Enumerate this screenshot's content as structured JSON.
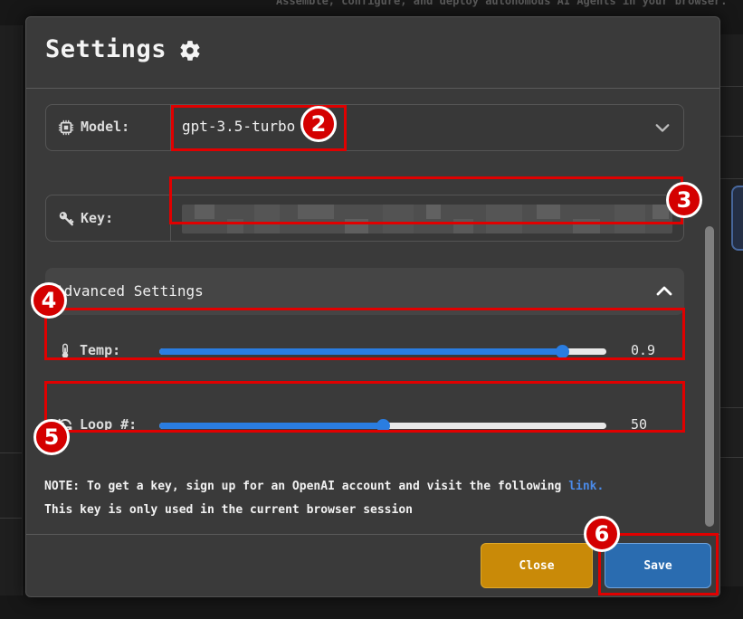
{
  "background": {
    "tagline": "Assemble, configure, and deploy autonomous AI Agents in your browser."
  },
  "modal": {
    "title": "Settings",
    "title_icon": "gear-icon",
    "model": {
      "label": "Model:",
      "icon": "chip-icon",
      "value": "gpt-3.5-turbo"
    },
    "key": {
      "label": "Key:",
      "icon": "key-icon",
      "value_note": "blurred API key"
    },
    "advanced": {
      "title": "Advanced Settings",
      "expanded": true,
      "temp": {
        "label": "Temp:",
        "icon": "thermometer-icon",
        "value": "0.9",
        "fraction": 0.9
      },
      "loop": {
        "label": "Loop #:",
        "icon": "refresh-icon",
        "value": "50",
        "fraction": 0.5
      }
    },
    "note_line1_prefix": "NOTE: To get a key, sign up for an OpenAI account and visit the following ",
    "note_link": "link.",
    "note_line2": "This key is only used in the current browser session",
    "buttons": {
      "close": "Close",
      "save": "Save"
    }
  },
  "annotations": [
    "2",
    "3",
    "4",
    "5",
    "6"
  ],
  "colors": {
    "accent_blue": "#2a7de1",
    "close_button": "#c98a08",
    "save_button": "#2a6cb0",
    "annotation_red": "#e00000"
  }
}
